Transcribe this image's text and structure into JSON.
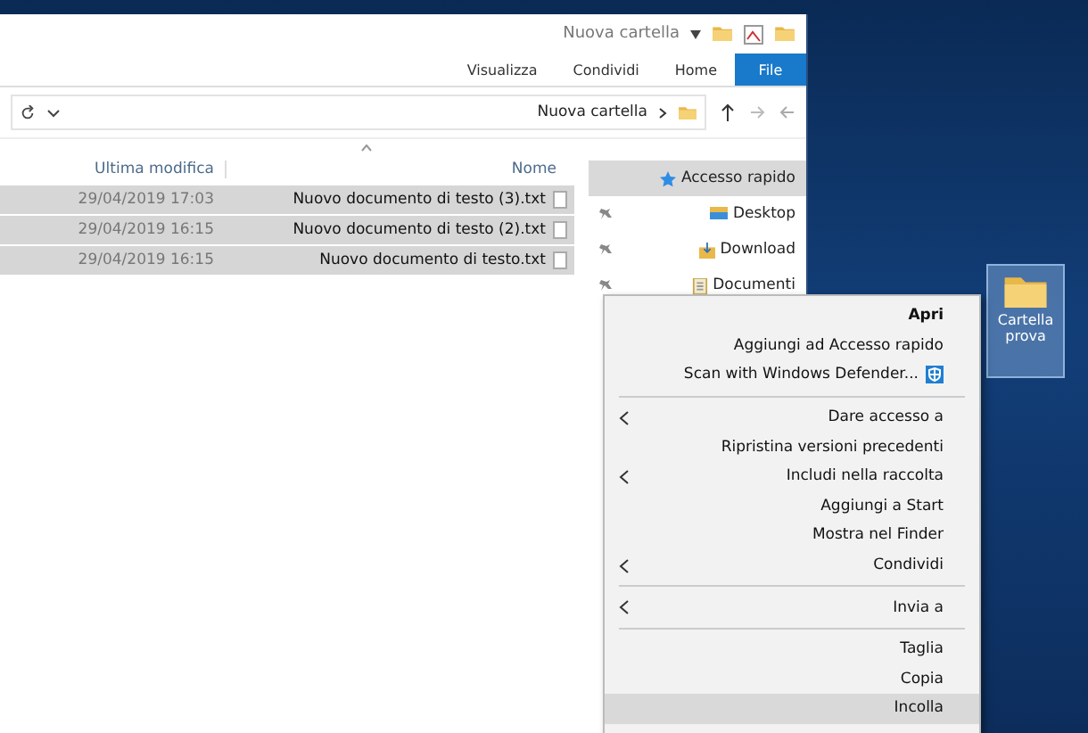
{
  "window": {
    "title": "Nuova cartella"
  },
  "ribbon_tabs": [
    {
      "label": "Visualizza",
      "selected": false
    },
    {
      "label": "Condividi",
      "selected": false
    },
    {
      "label": "Home",
      "selected": false
    },
    {
      "label": "File",
      "selected": true
    }
  ],
  "address": {
    "path": "Nuova cartella"
  },
  "columns": [
    "Ultima modifica",
    "Nome"
  ],
  "files": [
    {
      "name": "Nuovo documento di testo (3).txt",
      "modified": "29/04/2019 17:03",
      "selected": true
    },
    {
      "name": "Nuovo documento di testo (2).txt",
      "modified": "29/04/2019 16:15",
      "selected": true
    },
    {
      "name": "Nuovo documento di testo.txt",
      "modified": "29/04/2019 16:15",
      "selected": true
    }
  ],
  "nav_items": [
    {
      "label": "Accesso rapido",
      "kind": "star",
      "pinned": false,
      "selected": true
    },
    {
      "label": "Desktop",
      "kind": "desktop",
      "pinned": true,
      "selected": false
    },
    {
      "label": "Download",
      "kind": "download",
      "pinned": true,
      "selected": false
    },
    {
      "label": "Documenti",
      "kind": "documents",
      "pinned": true,
      "selected": false
    }
  ],
  "context_menu": [
    {
      "kind": "item",
      "label": "Apri",
      "bold": true,
      "submenu": false,
      "selected": false
    },
    {
      "kind": "item",
      "label": "Aggiungi ad Accesso rapido",
      "bold": false,
      "submenu": false,
      "selected": false
    },
    {
      "kind": "shield",
      "label": "Scan with Windows Defender...",
      "bold": false,
      "submenu": false,
      "selected": false
    },
    {
      "kind": "separator"
    },
    {
      "kind": "item",
      "label": "Dare accesso a",
      "bold": false,
      "submenu": true,
      "selected": false
    },
    {
      "kind": "item",
      "label": "Ripristina versioni precedenti",
      "bold": false,
      "submenu": false,
      "selected": false
    },
    {
      "kind": "item",
      "label": "Includi nella raccolta",
      "bold": false,
      "submenu": true,
      "selected": false
    },
    {
      "kind": "item",
      "label": "Aggiungi a Start",
      "bold": false,
      "submenu": false,
      "selected": false
    },
    {
      "kind": "item",
      "label": "Mostra nel Finder",
      "bold": false,
      "submenu": false,
      "selected": false
    },
    {
      "kind": "item",
      "label": "Condividi",
      "bold": false,
      "submenu": true,
      "selected": false
    },
    {
      "kind": "separator"
    },
    {
      "kind": "item",
      "label": "Invia a",
      "bold": false,
      "submenu": true,
      "selected": false
    },
    {
      "kind": "separator"
    },
    {
      "kind": "item",
      "label": "Taglia",
      "bold": false,
      "submenu": false,
      "selected": false
    },
    {
      "kind": "item",
      "label": "Copia",
      "bold": false,
      "submenu": false,
      "selected": false
    },
    {
      "kind": "item",
      "label": "Incolla",
      "bold": false,
      "submenu": false,
      "selected": true
    }
  ],
  "desktop_icon": {
    "label": "Cartella prova",
    "selected": true
  }
}
